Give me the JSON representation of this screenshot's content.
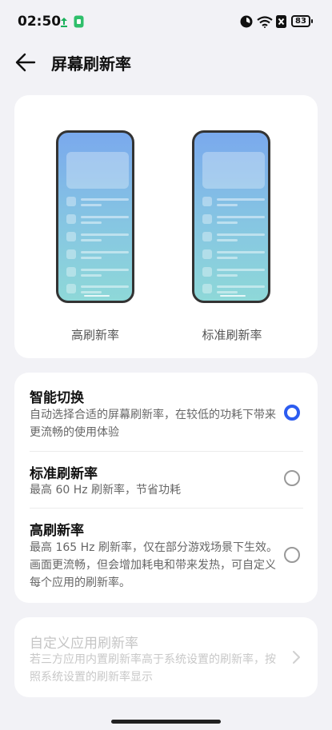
{
  "status_bar": {
    "time": "02:50",
    "battery": "83",
    "icons": [
      "sync-icon",
      "sim-icon",
      "status-circle-icon",
      "wifi-icon",
      "x-badge-icon",
      "battery-icon"
    ]
  },
  "header": {
    "back_icon": "arrow-left-icon",
    "title": "屏幕刷新率"
  },
  "preview": {
    "high_label": "高刷新率",
    "standard_label": "标准刷新率"
  },
  "options": [
    {
      "title": "智能切换",
      "desc": "自动选择合适的屏幕刷新率，在较低的功耗下带来更流畅的使用体验",
      "selected": true
    },
    {
      "title": "标准刷新率",
      "desc": "最高 60 Hz 刷新率，节省功耗",
      "selected": false
    },
    {
      "title": "高刷新率",
      "desc": "最高 165 Hz 刷新率，仅在部分游戏场景下生效。画面更流畅，但会增加耗电和带来发热，可自定义每个应用的刷新率。",
      "selected": false
    }
  ],
  "custom": {
    "title": "自定义应用刷新率",
    "desc": "若三方应用内置刷新率高于系统设置的刷新率，按照系统设置的刷新率显示",
    "chevron_icon": "chevron-right-icon"
  },
  "colors": {
    "accent": "#2c5cf0",
    "background": "#f2f2f6",
    "card": "#ffffff"
  }
}
